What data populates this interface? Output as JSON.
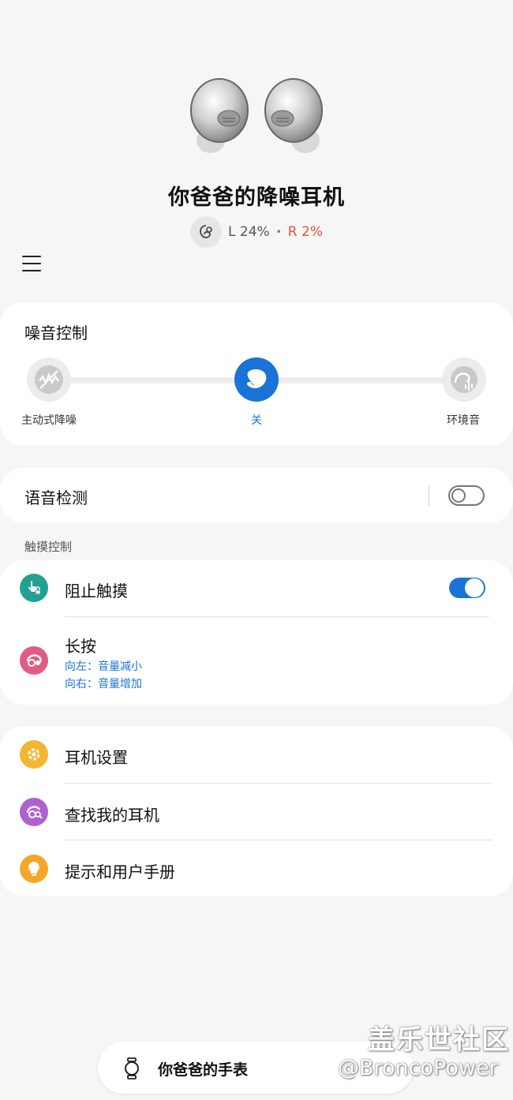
{
  "header": {
    "device_name": "你爸爸的降噪耳机",
    "battery_left": "L 24%",
    "separator": "•",
    "battery_right": "R 2%",
    "battery_right_color": "#e0533e"
  },
  "noise_control": {
    "title": "噪音控制",
    "modes": [
      {
        "label": "主动式降噪",
        "icon": "anc-icon",
        "selected": false
      },
      {
        "label": "关",
        "icon": "earbud-off-icon",
        "selected": true
      },
      {
        "label": "环境音",
        "icon": "ambient-sound-icon",
        "selected": false
      }
    ],
    "accent": "#1a73d6"
  },
  "voice_detect": {
    "label": "语音检测",
    "enabled": false
  },
  "touch_controls": {
    "section_label": "触摸控制",
    "block_touch": {
      "label": "阻止触摸",
      "enabled": true,
      "icon_color": "#23a092"
    },
    "long_press": {
      "label": "长按",
      "left": "向左：音量减小",
      "right": "向右：音量增加",
      "icon_color": "#e15b82"
    }
  },
  "settings": {
    "earbud_settings": "耳机设置",
    "find_my_earbuds": "查找我的耳机",
    "tips_manual": "提示和用户手册"
  },
  "bottom_bar": {
    "watch_name": "你爸爸的手表"
  },
  "watermark": {
    "line1": "盖乐世社区",
    "line2": "@BroncoPower"
  }
}
